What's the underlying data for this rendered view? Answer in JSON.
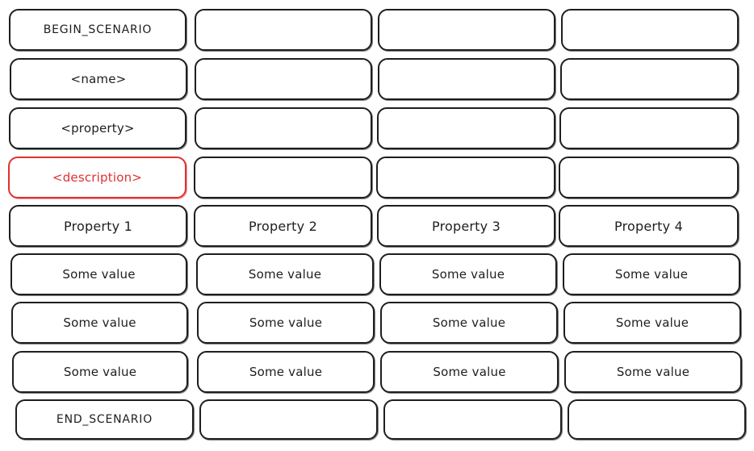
{
  "accent_color": "#e03131",
  "stroke_color": "#1e1e1e",
  "rows": [
    {
      "cells": [
        {
          "text": "BEGIN_SCENARIO",
          "style": "caps"
        },
        {
          "text": ""
        },
        {
          "text": ""
        },
        {
          "text": ""
        }
      ]
    },
    {
      "cells": [
        {
          "text": "<name>"
        },
        {
          "text": ""
        },
        {
          "text": ""
        },
        {
          "text": ""
        }
      ]
    },
    {
      "cells": [
        {
          "text": "<property>"
        },
        {
          "text": ""
        },
        {
          "text": ""
        },
        {
          "text": ""
        }
      ]
    },
    {
      "cells": [
        {
          "text": "<description>",
          "style": "red"
        },
        {
          "text": ""
        },
        {
          "text": ""
        },
        {
          "text": ""
        }
      ]
    },
    {
      "cells": [
        {
          "text": "Property 1",
          "style": "header"
        },
        {
          "text": "Property 2",
          "style": "header"
        },
        {
          "text": "Property 3",
          "style": "header"
        },
        {
          "text": "Property 4",
          "style": "header"
        }
      ]
    },
    {
      "cells": [
        {
          "text": "Some value"
        },
        {
          "text": "Some value"
        },
        {
          "text": "Some value"
        },
        {
          "text": "Some value"
        }
      ]
    },
    {
      "cells": [
        {
          "text": "Some value"
        },
        {
          "text": "Some value"
        },
        {
          "text": "Some value"
        },
        {
          "text": "Some value"
        }
      ]
    },
    {
      "cells": [
        {
          "text": "Some value"
        },
        {
          "text": "Some value"
        },
        {
          "text": "Some value"
        },
        {
          "text": "Some value"
        }
      ]
    },
    {
      "cells": [
        {
          "text": "END_SCENARIO",
          "style": "caps"
        },
        {
          "text": ""
        },
        {
          "text": ""
        },
        {
          "text": ""
        }
      ]
    }
  ]
}
